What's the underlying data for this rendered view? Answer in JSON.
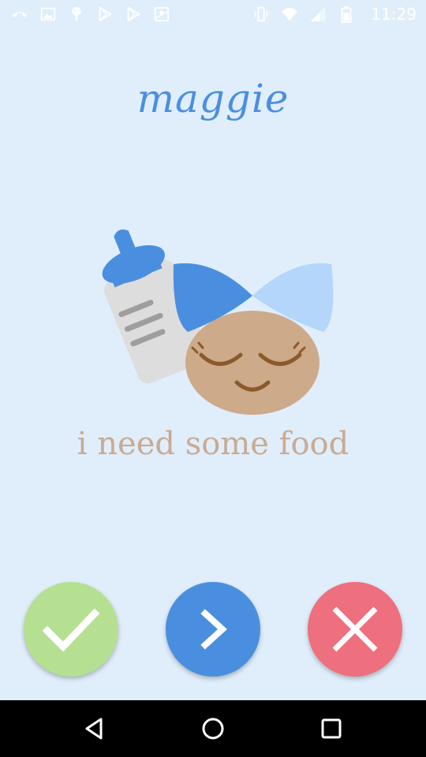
{
  "status_bar": {
    "time": "11:29",
    "left_icons": [
      "phone-icon",
      "image-icon",
      "android-icon",
      "play-store-icon",
      "play-store-icon",
      "maps-icon"
    ],
    "right_icons": [
      "vibrate-icon",
      "wifi-icon",
      "signal-icon",
      "battery-icon"
    ]
  },
  "profile": {
    "name": "maggie"
  },
  "request": {
    "message": "i need some food",
    "illustration": "baby-bottle-icon"
  },
  "actions": {
    "confirm_icon": "checkmark-icon",
    "next_icon": "chevron-right-icon",
    "cancel_icon": "close-icon"
  },
  "colors": {
    "background": "#E0EEFC",
    "name": "#4A8FDF",
    "message": "#C9AB91",
    "confirm": "#B6E091",
    "next": "#4A8FDF",
    "cancel": "#EE6F7D",
    "bow_dark": "#4A8FDF",
    "bow_light": "#B3D6FA",
    "face": "#CDAA8A"
  },
  "nav_bar": {
    "buttons": [
      "back-icon",
      "home-icon",
      "recent-apps-icon"
    ]
  }
}
